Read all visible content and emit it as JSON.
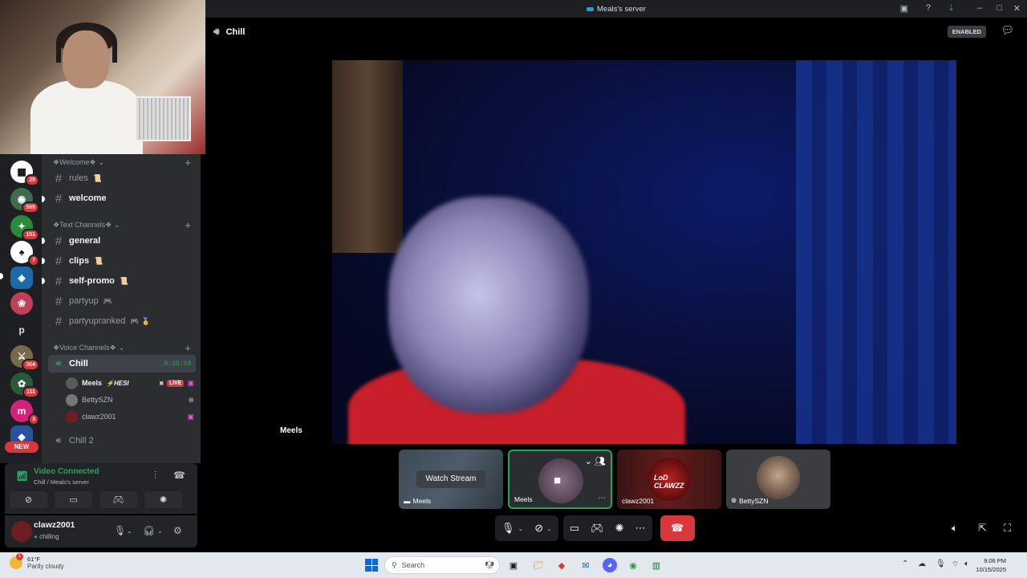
{
  "window": {
    "title": "Meals's server"
  },
  "servers": {
    "badges": [
      "25",
      "565",
      "151",
      "7",
      "304",
      "111",
      "3"
    ],
    "letter": "p",
    "new_label": "NEW"
  },
  "channels": {
    "category_welcome": "❖Welcome❖",
    "category_text": "❖Text Channels❖",
    "category_voice": "❖Voice Channels❖",
    "items": [
      {
        "name": "rules",
        "emoji": "📜"
      },
      {
        "name": "welcome",
        "emoji": ""
      },
      {
        "name": "general",
        "emoji": ""
      },
      {
        "name": "clips",
        "emoji": "📜"
      },
      {
        "name": "self-promo",
        "emoji": "📜"
      },
      {
        "name": "partyup",
        "emoji": "🎮"
      },
      {
        "name": "partyupranked",
        "emoji": "🎮 🏅"
      }
    ],
    "voice": {
      "name": "Chill",
      "timer": "8:35:39",
      "users": [
        {
          "name": "Meels",
          "tag": "⚡HESI",
          "live": "LIVE"
        },
        {
          "name": "BettySZN"
        },
        {
          "name": "clawz2001"
        }
      ],
      "second": "Chill 2"
    }
  },
  "voice_panel": {
    "status": "Video Connected",
    "location": "Chill / Meals's server"
  },
  "user_panel": {
    "name": "clawz2001",
    "status": "chilling"
  },
  "stage": {
    "channel": "Chill",
    "enabled_badge": "ENABLED",
    "main_video_name": "Meels",
    "tiles": [
      {
        "name": "Meels",
        "action": "Watch Stream"
      },
      {
        "name": "Meels"
      },
      {
        "name": "clawz2001",
        "avatar_text": "LoD CLAWZZ"
      },
      {
        "name": "BettySZN"
      }
    ]
  },
  "taskbar": {
    "temperature": "61°F",
    "weather": "Partly cloudy",
    "search_placeholder": "Search",
    "time": "9:06 PM",
    "date": "10/15/2025"
  }
}
